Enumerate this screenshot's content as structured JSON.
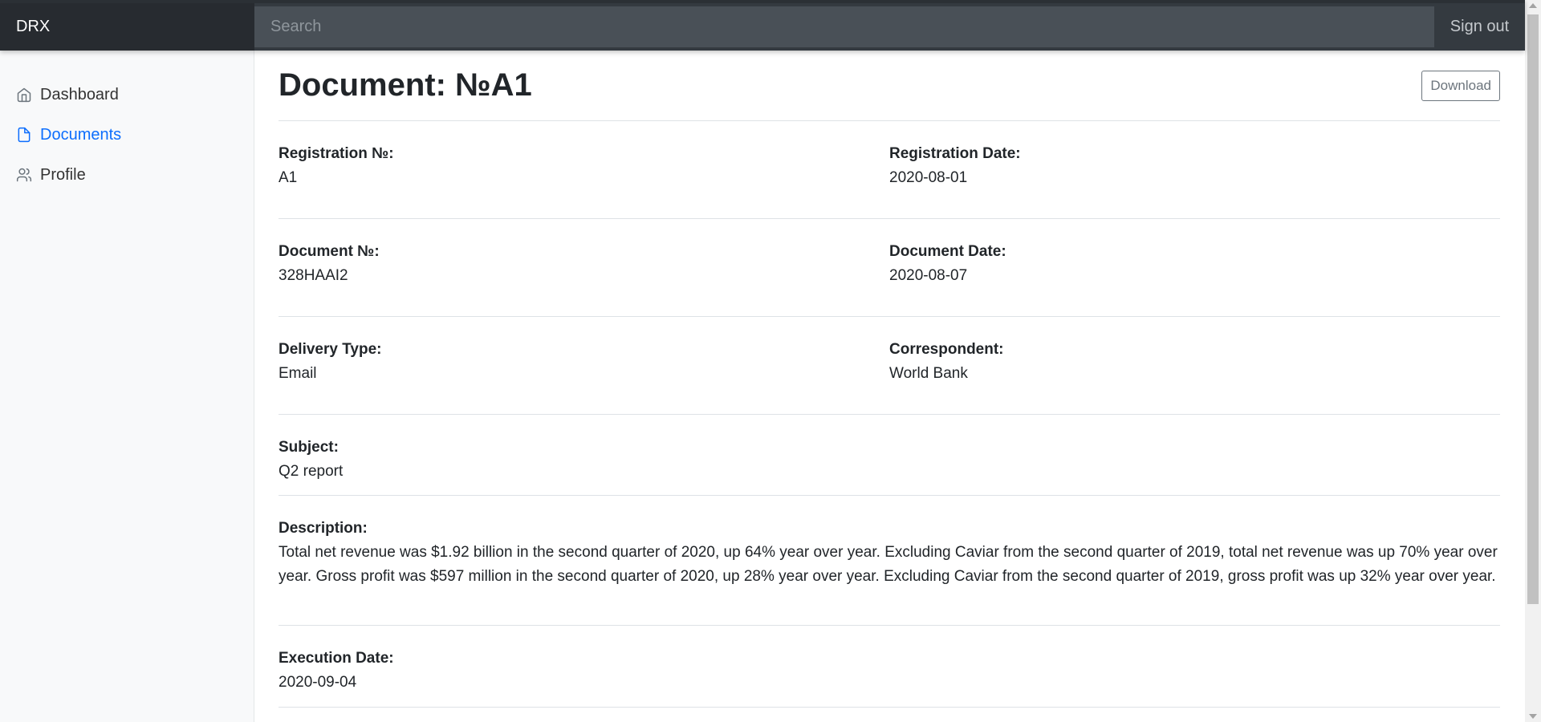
{
  "topbar": {
    "brand": "DRX",
    "search_placeholder": "Search",
    "signout_label": "Sign out"
  },
  "sidebar": {
    "items": [
      {
        "label": "Dashboard",
        "icon": "home-icon"
      },
      {
        "label": "Documents",
        "icon": "file-icon",
        "active": true
      },
      {
        "label": "Profile",
        "icon": "users-icon"
      }
    ],
    "active_color": "#0d6efd"
  },
  "document": {
    "title": "Document: №A1",
    "download_label": "Download",
    "registration_no": {
      "label": "Registration №:",
      "value": "A1"
    },
    "registration_date": {
      "label": "Registration Date:",
      "value": "2020-08-01"
    },
    "document_no": {
      "label": "Document №:",
      "value": "328HAAI2"
    },
    "document_date": {
      "label": "Document Date:",
      "value": "2020-08-07"
    },
    "delivery_type": {
      "label": "Delivery Type:",
      "value": "Email"
    },
    "correspondent": {
      "label": "Correspondent:",
      "value": "World Bank"
    },
    "subject": {
      "label": "Subject:",
      "value": "Q2 report"
    },
    "description": {
      "label": "Description:",
      "value": "Total net revenue was $1.92 billion in the second quarter of 2020, up 64% year over year. Excluding Caviar from the second quarter of 2019, total net revenue was up 70% year over year. Gross profit was $597 million in the second quarter of 2020, up 28% year over year. Excluding Caviar from the second quarter of 2019, gross profit was up 32% year over year."
    },
    "execution_date": {
      "label": "Execution Date:",
      "value": "2020-09-04"
    }
  }
}
